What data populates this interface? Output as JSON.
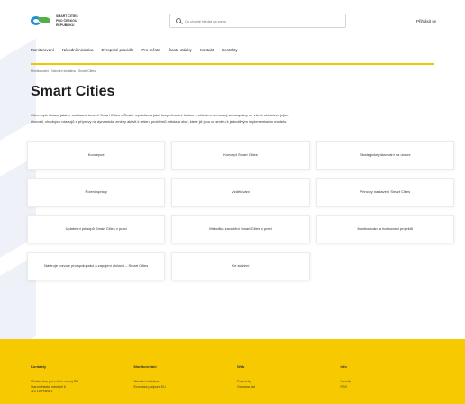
{
  "header": {
    "logo_lines": [
      "SMART CITIES",
      "PRO ČESKOU",
      "REPUBLIKU"
    ],
    "search_placeholder": "Co chcete hledat na webu",
    "login_label": "Přihlásit se"
  },
  "nav": {
    "items": [
      "Monitorování",
      "Národní iniciativa",
      "Evropské pravidlo",
      "Pro města",
      "Časté otázky",
      "Kontakt",
      "Kontakty"
    ]
  },
  "breadcrumb": "Monitorování / Národní iniciativa / Smart Cities",
  "page_title": "Smart Cities",
  "intro": "Cílem bylo ukázat jaká je současná úroveň Smart Cities v České republice a jaké bezpečnostní funkce s ohledem na rozvoj samosprávy ve všech oblastech jejich činností, vhodných nástrojů a přípravy na dynamické změny aktivit k řešení problémů města a obcí, které již jsou ve směru k jednotlivým implementacím modelu.",
  "cards": [
    "Koncepce",
    "Koncept Smart Cities",
    "Strategické plánování na úrovni",
    "Řízení správy",
    "Vzdělávání",
    "Principy nastavení Smart Cities",
    "Uplatnění principů Smart Cities v praxi",
    "Metodika zavádění Smart Cities v praxi",
    "Monitorování a hodnocení projektů",
    "Nástroje rozvoje pro spolupráci a zapojení občanů – Smart Cities",
    "Ke stažení"
  ],
  "footer": {
    "columns": [
      {
        "title": "Kontakty",
        "lines": [
          "Ministerstvo pro místní rozvoj ČR",
          "Staroměstské náměstí 6",
          "110 15 Praha 1"
        ]
      },
      {
        "title": "Monitorování",
        "lines": [
          "Národní iniciativa",
          "Evropská podpora EU"
        ]
      },
      {
        "title": "Web",
        "lines": [
          "Podmínky",
          "Ochrana dat"
        ]
      },
      {
        "title": "Info",
        "lines": [
          "Novinky",
          "RSS"
        ]
      }
    ]
  },
  "colors": {
    "accent_yellow": "#f7c900",
    "logo_blue": "#1f8fd6",
    "logo_green": "#52b04a"
  }
}
